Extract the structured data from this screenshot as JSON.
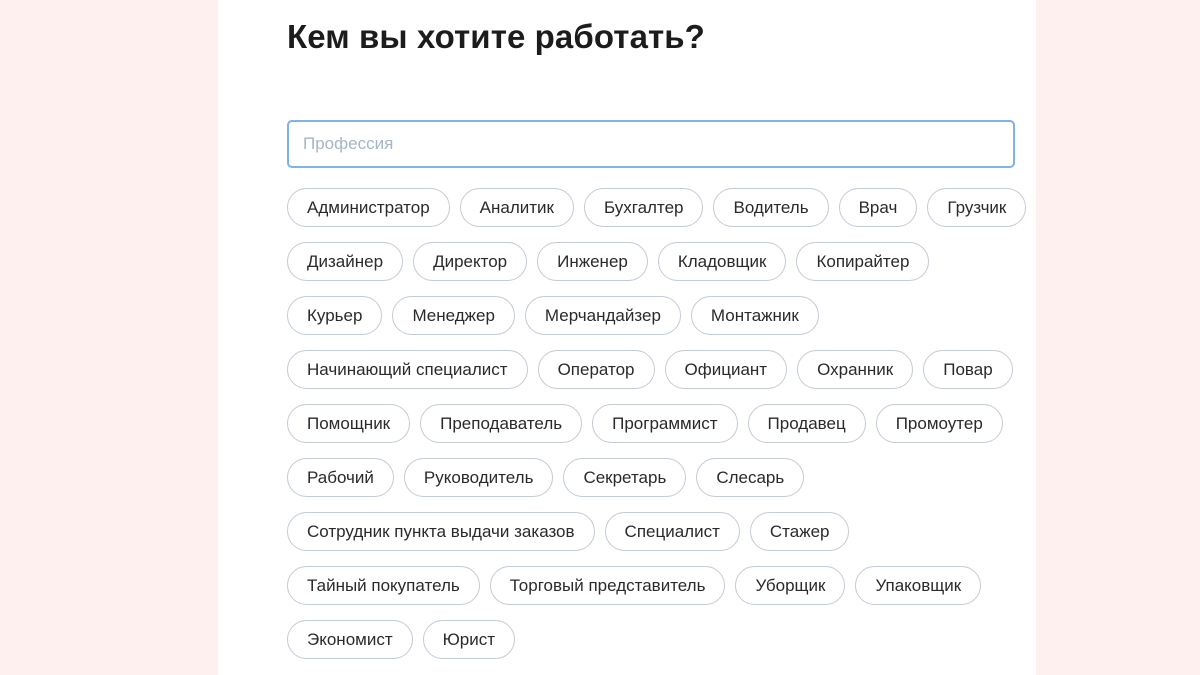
{
  "page": {
    "title": "Кем вы хотите работать?"
  },
  "search": {
    "placeholder": "Профессия",
    "value": ""
  },
  "professions": [
    "Администратор",
    "Аналитик",
    "Бухгалтер",
    "Водитель",
    "Врач",
    "Грузчик",
    "Дизайнер",
    "Директор",
    "Инженер",
    "Кладовщик",
    "Копирайтер",
    "Курьер",
    "Менеджер",
    "Мерчандайзер",
    "Монтажник",
    "Начинающий специалист",
    "Оператор",
    "Официант",
    "Охранник",
    "Повар",
    "Помощник",
    "Преподаватель",
    "Программист",
    "Продавец",
    "Промоутер",
    "Рабочий",
    "Руководитель",
    "Секретарь",
    "Слесарь",
    "Сотрудник пункта выдачи заказов",
    "Специалист",
    "Стажер",
    "Тайный покупатель",
    "Торговый представитель",
    "Уборщик",
    "Упаковщик",
    "Экономист",
    "Юрист"
  ],
  "colors": {
    "page_background": "#fdf0ef",
    "card_background": "#ffffff",
    "input_border_focus": "#7fb3e8",
    "chip_border": "#c3cbd5",
    "text": "#1c1c1c",
    "placeholder": "#a7b5c7"
  }
}
